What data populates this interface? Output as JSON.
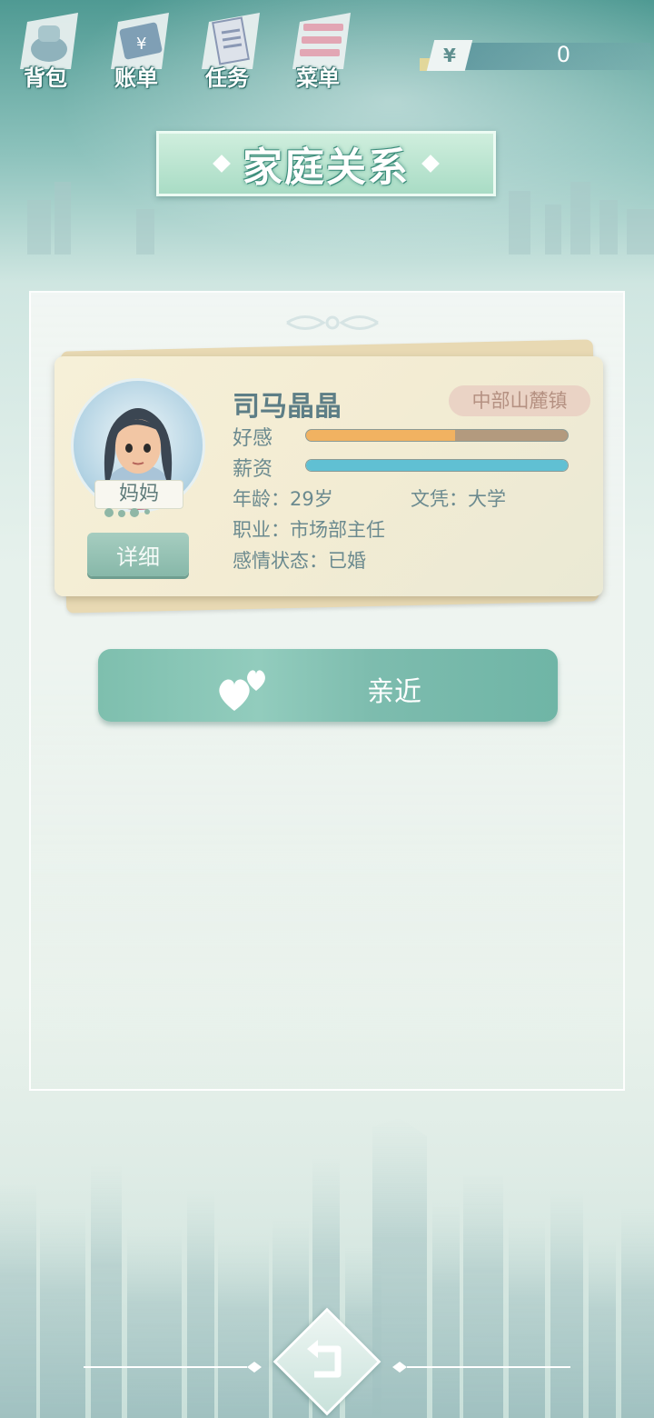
{
  "toolbar": {
    "items": [
      {
        "label": "背包",
        "icon": "backpack-icon"
      },
      {
        "label": "账单",
        "icon": "bill-icon"
      },
      {
        "label": "任务",
        "icon": "task-icon"
      },
      {
        "label": "菜单",
        "icon": "menu-icon"
      }
    ]
  },
  "currency": {
    "symbol": "¥",
    "amount": "0"
  },
  "header": {
    "title": "家庭关系"
  },
  "character": {
    "name": "司马晶晶",
    "location": "中部山麓镇",
    "relation": "妈妈",
    "favor_label": "好感",
    "favor_level": 0.57,
    "salary_label": "薪资",
    "salary_level": 1.0,
    "age": "年龄：29岁",
    "education": "文凭：大学",
    "occupation": "职业：市场部主任",
    "marital_status": "感情状态：已婚",
    "detail_button": "详细"
  },
  "actions": {
    "approach_label": "亲近"
  },
  "colors": {
    "accent": "#7ebfae",
    "favor_bar": "#f1b261",
    "salary_bar": "#60c0d3",
    "title_text": "#5d7e86"
  }
}
